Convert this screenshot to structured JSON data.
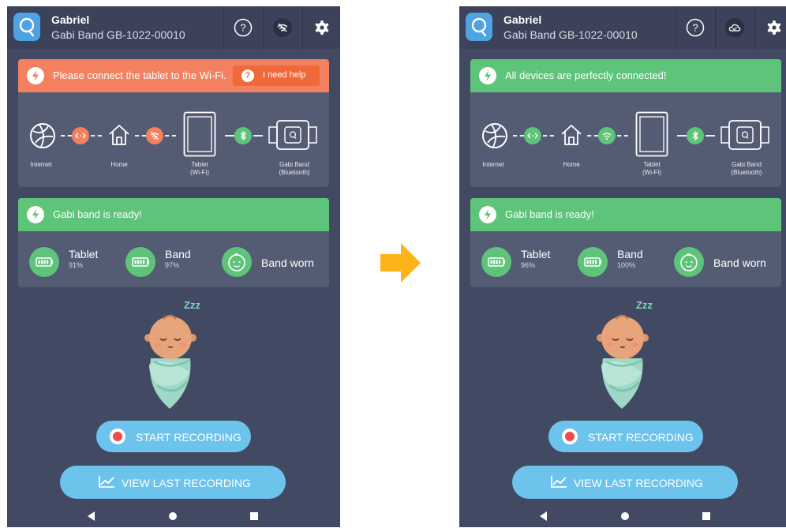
{
  "colors": {
    "background": "#424a63",
    "topbar": "#3b4259",
    "card": "#545c74",
    "warning": "#f3815f",
    "success": "#5ec47a",
    "button": "#6cc3ec",
    "record": "#ef4c4c",
    "arrow": "#fbb41a"
  },
  "screens": [
    {
      "header": {
        "user_name": "Gabriel",
        "device_id": "Gabi Band GB-1022-00010",
        "icons": [
          "help-icon",
          "wifi-off-icon",
          "gear-icon"
        ]
      },
      "connection": {
        "status_text": "Please connect the tablet to the Wi-Fi.",
        "help_label": "I need help",
        "status": "warning"
      },
      "diagram": {
        "internet": "Internet",
        "home": "Home",
        "tablet_line1": "Tablet",
        "tablet_line2": "(Wi-Fi)",
        "band_line1": "Gabi Band",
        "band_line2": "(Bluetooth)"
      },
      "ready": {
        "text": "Gabi band is ready!"
      },
      "stats": {
        "tablet_label": "Tablet",
        "tablet_value": "91%",
        "band_label": "Band",
        "band_value": "97%",
        "worn_label": "Band worn"
      },
      "zzz": "Zzz",
      "buttons": {
        "start": "START RECORDING",
        "view": "VIEW LAST RECORDING"
      }
    },
    {
      "header": {
        "user_name": "Gabriel",
        "device_id": "Gabi Band GB-1022-00010",
        "icons": [
          "help-icon",
          "cloud-check-icon",
          "gear-icon"
        ]
      },
      "connection": {
        "status_text": "All devices are perfectly connected!",
        "status": "ok"
      },
      "diagram": {
        "internet": "Internet",
        "home": "Home",
        "tablet_line1": "Tablet",
        "tablet_line2": "(Wi-Fi)",
        "band_line1": "Gabi Band",
        "band_line2": "(Bluetooth)"
      },
      "ready": {
        "text": "Gabi band is ready!"
      },
      "stats": {
        "tablet_label": "Tablet",
        "tablet_value": "96%",
        "band_label": "Band",
        "band_value": "100%",
        "worn_label": "Band worn"
      },
      "zzz": "Zzz",
      "buttons": {
        "start": "START RECORDING",
        "view": "VIEW LAST RECORDING"
      }
    }
  ]
}
